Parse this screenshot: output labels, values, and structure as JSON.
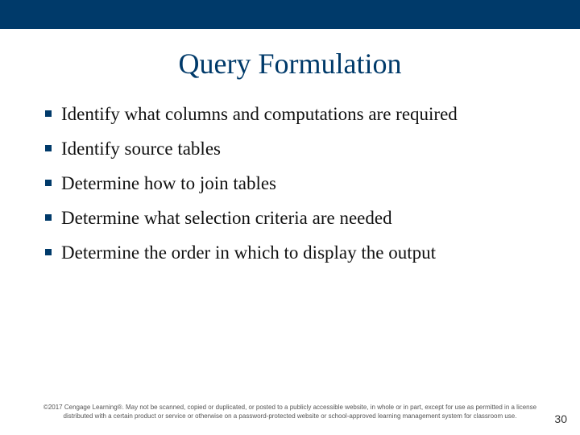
{
  "title": "Query Formulation",
  "bullets": [
    "Identify what columns and computations are required",
    "Identify source tables",
    "Determine how to join tables",
    "Determine what selection criteria are needed",
    "Determine the order in which to display the output"
  ],
  "copyright": "©2017 Cengage Learning®. May not be scanned, copied or duplicated, or posted to a publicly accessible website, in whole or in part, except for use as permitted in a license distributed with a certain product or service or otherwise on a password-protected website or school-approved learning management system for classroom use.",
  "page_number": "30"
}
